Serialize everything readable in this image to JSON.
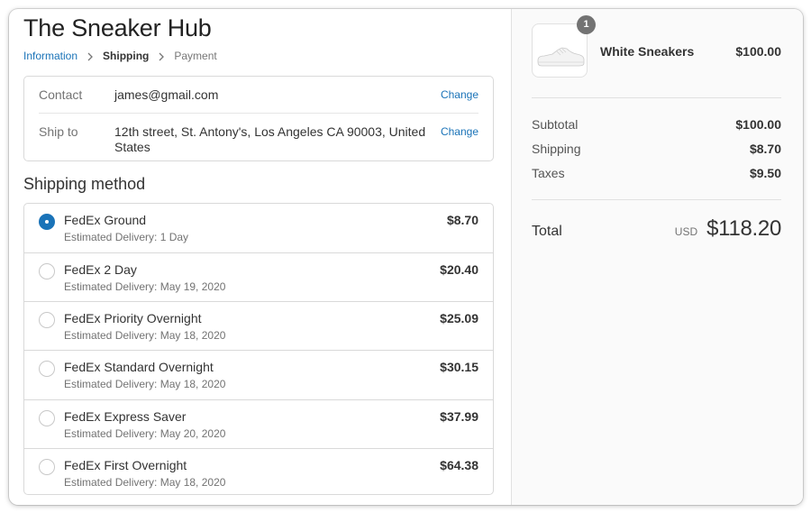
{
  "shop": {
    "title": "The Sneaker Hub"
  },
  "breadcrumb": {
    "information": "Information",
    "shipping": "Shipping",
    "payment": "Payment"
  },
  "review": {
    "contact_label": "Contact",
    "contact_value": "james@gmail.com",
    "ship_label": "Ship to",
    "ship_value": "12th street, St. Antony's, Los Angeles CA 90003, United States",
    "change_label": "Change"
  },
  "shipping_method": {
    "title": "Shipping method",
    "selected_index": 0,
    "options": [
      {
        "name": "FedEx Ground",
        "eta": "Estimated Delivery: 1 Day",
        "price": "$8.70"
      },
      {
        "name": "FedEx 2 Day",
        "eta": "Estimated Delivery: May 19, 2020",
        "price": "$20.40"
      },
      {
        "name": "FedEx Priority Overnight",
        "eta": "Estimated Delivery: May 18, 2020",
        "price": "$25.09"
      },
      {
        "name": "FedEx Standard Overnight",
        "eta": "Estimated Delivery: May 18, 2020",
        "price": "$30.15"
      },
      {
        "name": "FedEx Express Saver",
        "eta": "Estimated Delivery: May 20, 2020",
        "price": "$37.99"
      },
      {
        "name": "FedEx First Overnight",
        "eta": "Estimated Delivery: May 18, 2020",
        "price": "$64.38"
      }
    ]
  },
  "order": {
    "product": {
      "name": "White Sneakers",
      "price": "$100.00",
      "quantity": "1",
      "image_icon": "sneaker-icon"
    },
    "subtotal_label": "Subtotal",
    "subtotal_value": "$100.00",
    "shipping_label": "Shipping",
    "shipping_value": "$8.70",
    "taxes_label": "Taxes",
    "taxes_value": "$9.50",
    "total_label": "Total",
    "total_currency": "USD",
    "total_value": "$118.20"
  },
  "colors": {
    "accent": "#1a73b8",
    "sidebar_bg": "#fafafa",
    "border": "#d9d9d9"
  }
}
